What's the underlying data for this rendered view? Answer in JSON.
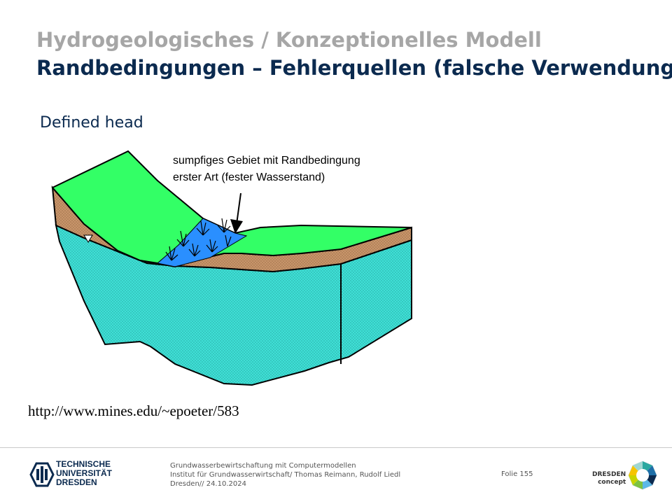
{
  "slide": {
    "title_line1": "Hydrogeologisches / Konzeptionelles Modell",
    "title_line2": "Randbedingungen – Fehlerquellen (falsche Verwendung)",
    "subtitle": "Defined head",
    "annotation_line1": "sumpfiges Gebiet mit Randbedingung",
    "annotation_line2": "erster Art (fester Wasserstand)",
    "source_url": "http://www.mines.edu/~epoeter/583"
  },
  "footer": {
    "university_line1": "TECHNISCHE",
    "university_line2": "UNIVERSITÄT",
    "university_line3": "DRESDEN",
    "course": "Grundwasserbewirtschaftung mit Computermodellen",
    "institute": "Institut für Grundwasserwirtschaft/ Thomas Reimann, Rudolf Liedl",
    "place_date": "Dresden// 24.10.2024",
    "page": "Folie 155",
    "dresden_line1": "DRESDEN",
    "dresden_line2": "concept"
  },
  "colors": {
    "title_gray": "#a6a6a6",
    "title_navy": "#0b2a4f",
    "surface_green": "#33ff66",
    "soil_brown": "#c8956a",
    "aquifer_cyan": "#3fe0d6",
    "wetland_blue": "#2a8fff"
  },
  "icons": {
    "university_logo": "tud-logo-icon",
    "partner_logo": "dresden-concept-logo-icon",
    "water_table_marker": "water-table-triangle-icon"
  }
}
